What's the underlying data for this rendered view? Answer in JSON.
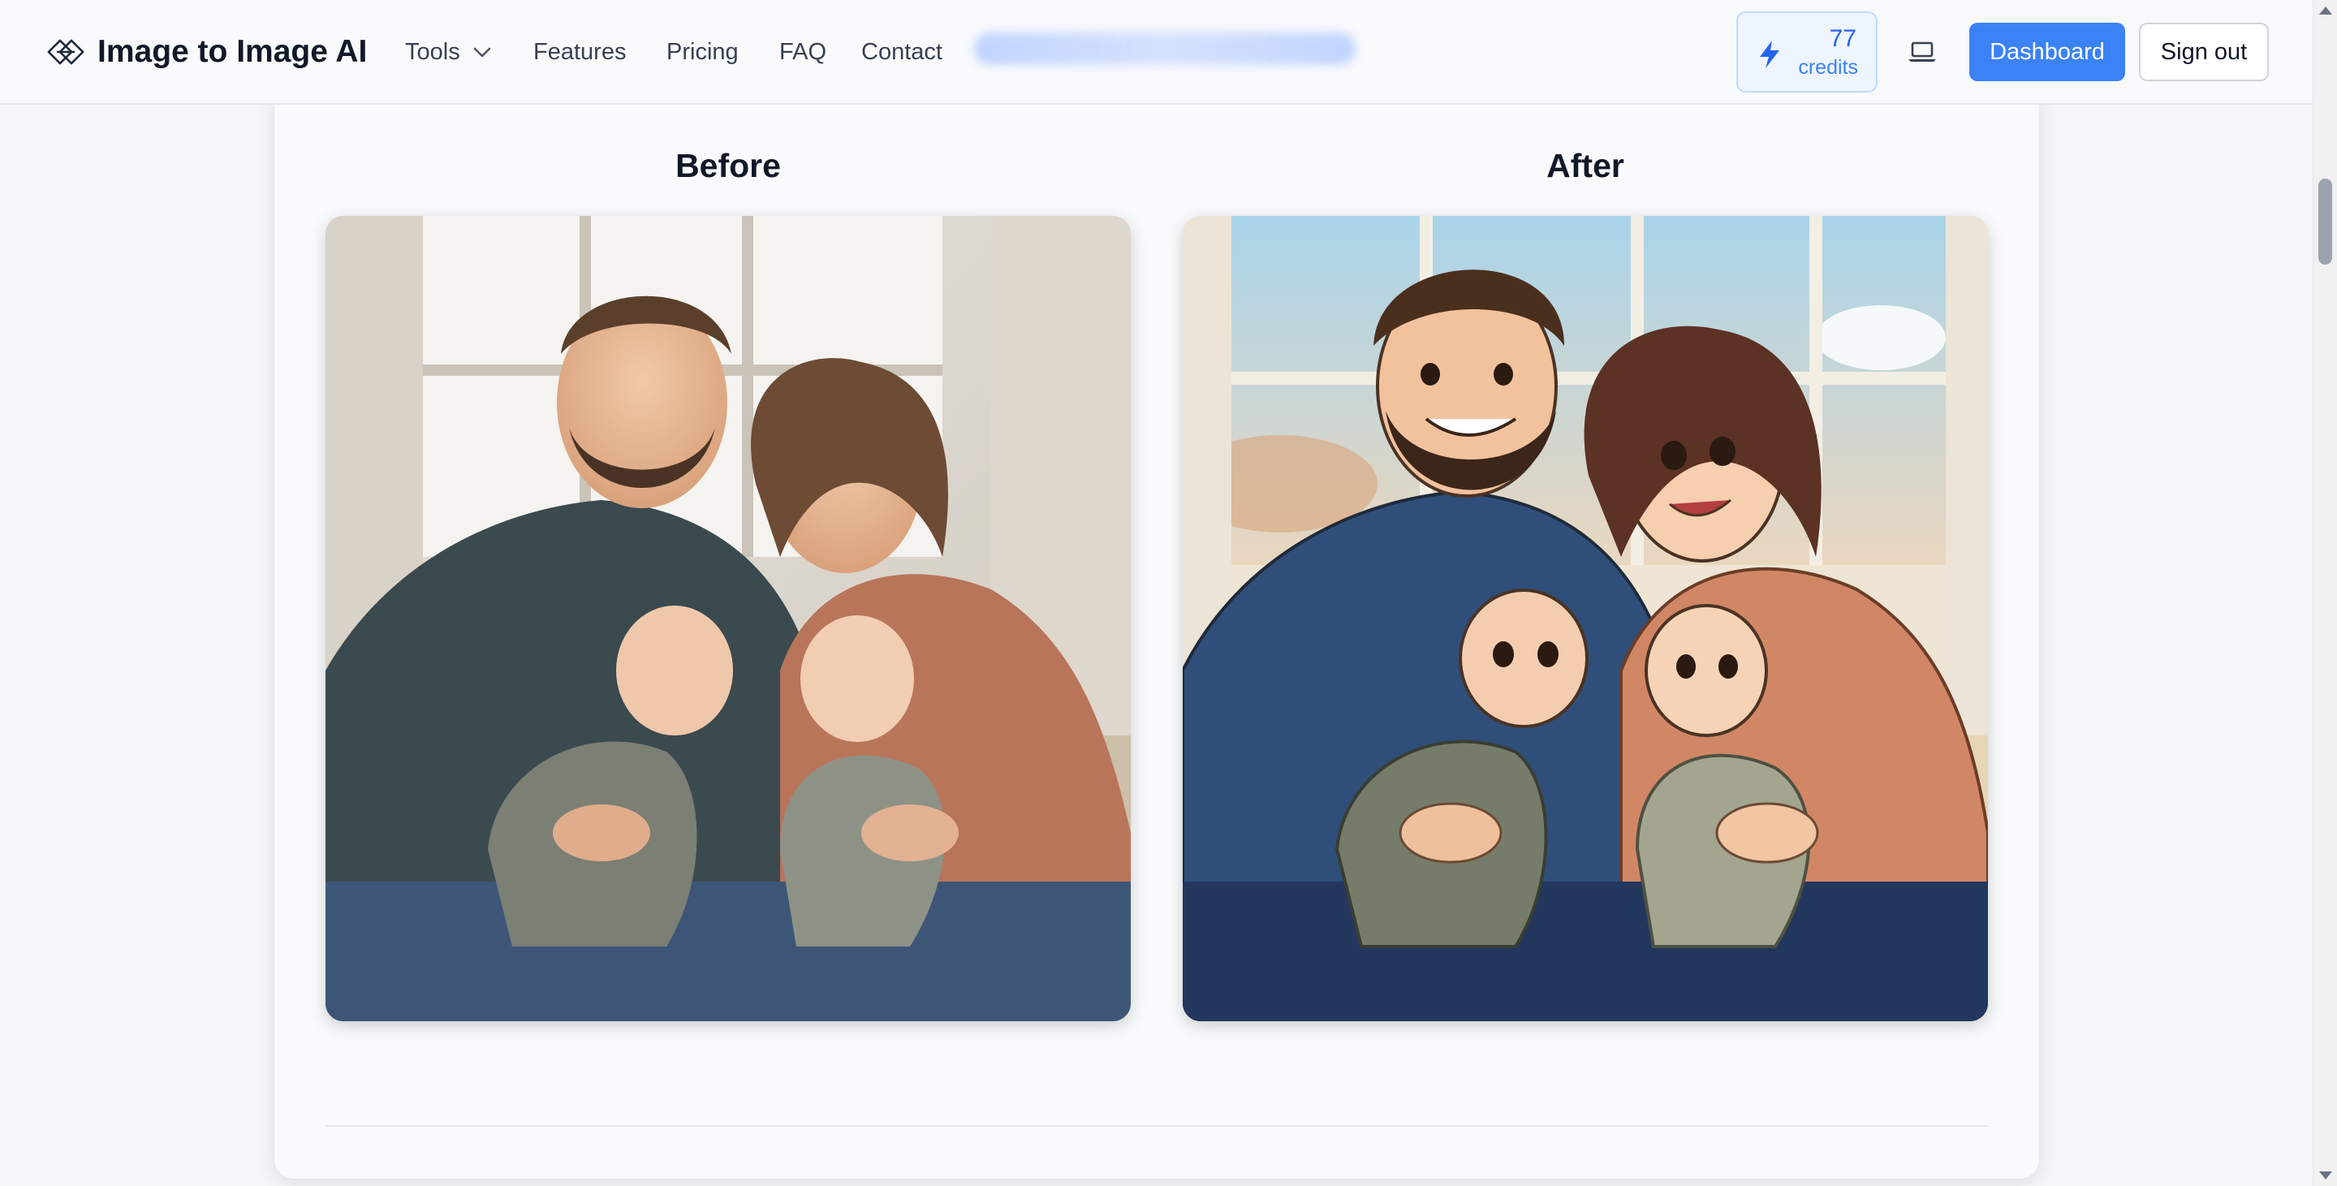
{
  "header": {
    "brand": "Image to Image AI",
    "nav": {
      "tools": "Tools",
      "features": "Features",
      "pricing": "Pricing",
      "faq": "FAQ",
      "contact": "Contact"
    },
    "credits": {
      "value": "77",
      "label": "credits"
    },
    "dashboard_label": "Dashboard",
    "signout_label": "Sign out"
  },
  "icons": {
    "logo": "diamond-stack-logo-icon",
    "tools_chevron": "chevron-down-icon",
    "credits": "lightning-bolt-icon",
    "display_mode": "laptop-icon"
  },
  "comparison": {
    "before_title": "Before",
    "after_title": "After"
  },
  "colors": {
    "accent": "#3b82f6",
    "credits_text": "#2563eb",
    "credits_bg": "#eef5ff",
    "text_dark": "#111827",
    "nav_text": "#374151"
  }
}
